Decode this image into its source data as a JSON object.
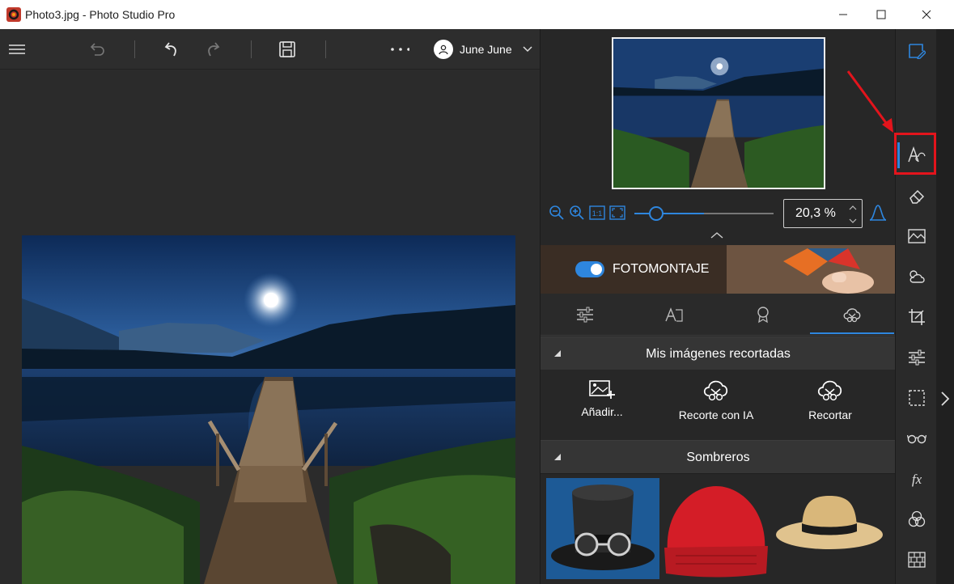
{
  "window": {
    "title": "Photo3.jpg - Photo Studio Pro"
  },
  "toolbar": {
    "menu_icon": "hamburger-menu-icon",
    "user_name": "June June"
  },
  "zoom": {
    "value": "20,3 %",
    "slider_level": 0.1
  },
  "montage": {
    "label": "FOTOMONTAJE",
    "enabled": true
  },
  "tabs": [
    {
      "name": "adjustments-icon"
    },
    {
      "name": "text-icon"
    },
    {
      "name": "award-icon"
    },
    {
      "name": "cutout-icon",
      "active": true
    }
  ],
  "sections": {
    "cutouts": "Mis imágenes recortadas",
    "hats": "Sombreros"
  },
  "actions": [
    {
      "label": "Añadir...",
      "icon": "add-image-icon"
    },
    {
      "label": "Recorte con IA",
      "icon": "ai-cutout-icon"
    },
    {
      "label": "Recortar",
      "icon": "cutout-icon"
    }
  ],
  "hats": [
    {
      "name": "top-hat-goggles",
      "selected": true
    },
    {
      "name": "red-beanie"
    },
    {
      "name": "straw-hat"
    }
  ],
  "rail": [
    "edit-icon",
    "montage-icon",
    "eraser-icon",
    "landscape-icon",
    "weather-icon",
    "crop-icon",
    "sliders-icon",
    "selection-icon",
    "glasses-icon",
    "fx-icon",
    "color-circles-icon",
    "texture-icon"
  ],
  "colors": {
    "accent": "#2e86de",
    "highlight": "#e3141c"
  }
}
